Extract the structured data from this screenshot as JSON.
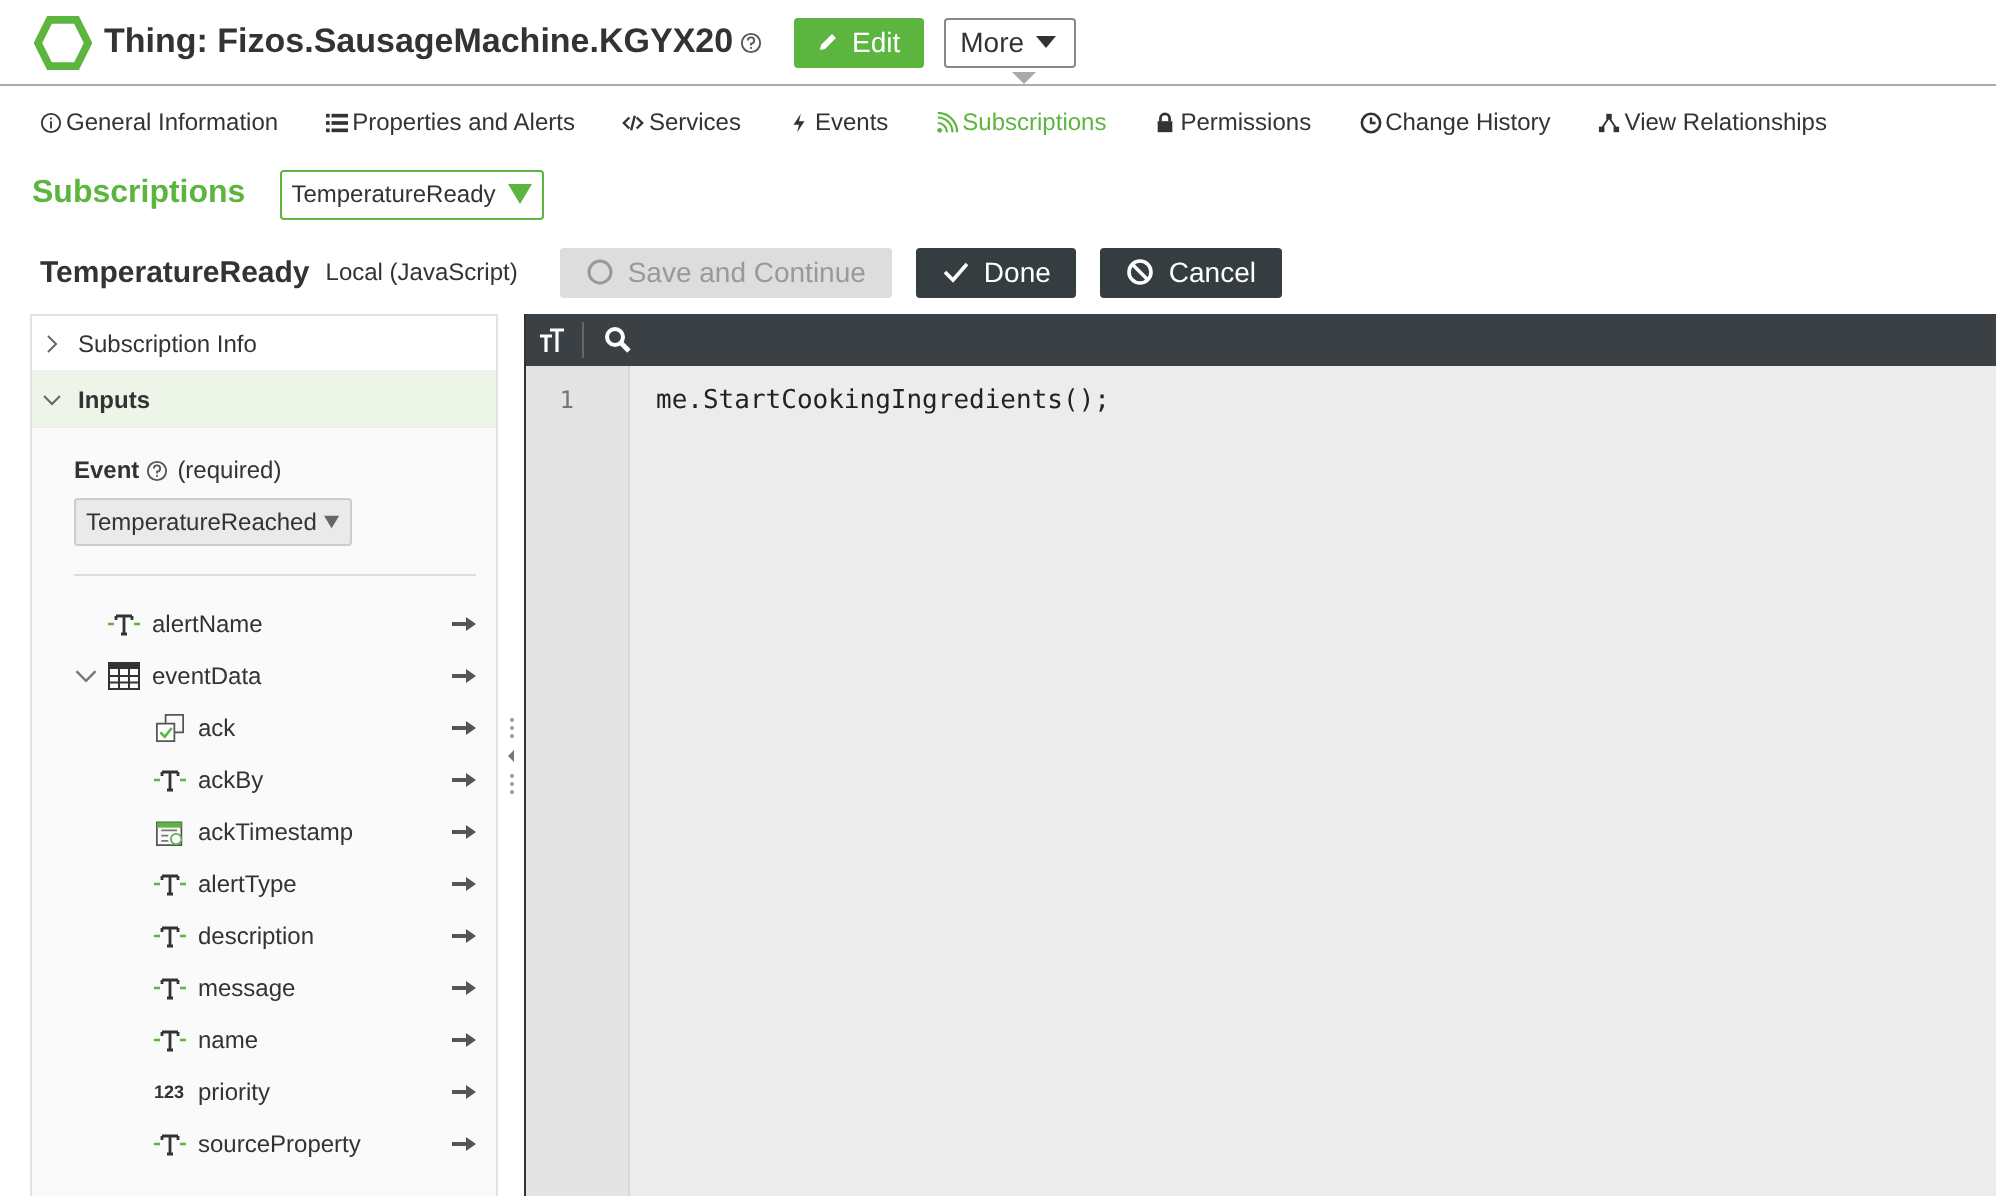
{
  "header": {
    "title": "Thing: Fizos.SausageMachine.KGYX20",
    "edit_button": "Edit",
    "more_button": "More"
  },
  "tabs": [
    {
      "label": "General Information",
      "kind": "info",
      "selected": false
    },
    {
      "label": "Properties and Alerts",
      "kind": "list",
      "selected": false
    },
    {
      "label": "Services",
      "kind": "code",
      "selected": false
    },
    {
      "label": "Events",
      "kind": "bolt",
      "selected": false
    },
    {
      "label": "Subscriptions",
      "kind": "feed",
      "selected": true
    },
    {
      "label": "Permissions",
      "kind": "lock",
      "selected": false
    },
    {
      "label": "Change History",
      "kind": "clock",
      "selected": false
    },
    {
      "label": "View Relationships",
      "kind": "graph",
      "selected": false
    }
  ],
  "page": {
    "heading": "Subscriptions",
    "subscription_select": "TemperatureReady"
  },
  "subscription": {
    "name": "TemperatureReady",
    "type": "Local (JavaScript)"
  },
  "actions": [
    {
      "label": "Save and Continue",
      "kind": "save",
      "disabled": true
    },
    {
      "label": "Done",
      "kind": "done",
      "disabled": false
    },
    {
      "label": "Cancel",
      "kind": "cancel",
      "disabled": false
    }
  ],
  "sections": [
    {
      "label": "Subscription Info",
      "expanded": false
    },
    {
      "label": "Inputs",
      "expanded": true
    }
  ],
  "inputs": {
    "event_label": "Event",
    "required_note": "(required)",
    "event_select": "TemperatureReached",
    "fields": [
      {
        "name": "alertName",
        "kind": "string"
      },
      {
        "name": "eventData",
        "kind": "infotable",
        "expanded": true,
        "children": [
          {
            "name": "ack",
            "kind": "boolean"
          },
          {
            "name": "ackBy",
            "kind": "string"
          },
          {
            "name": "ackTimestamp",
            "kind": "datetime"
          },
          {
            "name": "alertType",
            "kind": "string"
          },
          {
            "name": "description",
            "kind": "string"
          },
          {
            "name": "message",
            "kind": "string"
          },
          {
            "name": "name",
            "kind": "string"
          },
          {
            "name": "priority",
            "kind": "number",
            "badge": "123"
          },
          {
            "name": "sourceProperty",
            "kind": "string"
          }
        ]
      }
    ]
  },
  "editor": {
    "lines": [
      {
        "number": "1",
        "code": "me.StartCookingIngredients();"
      }
    ]
  }
}
